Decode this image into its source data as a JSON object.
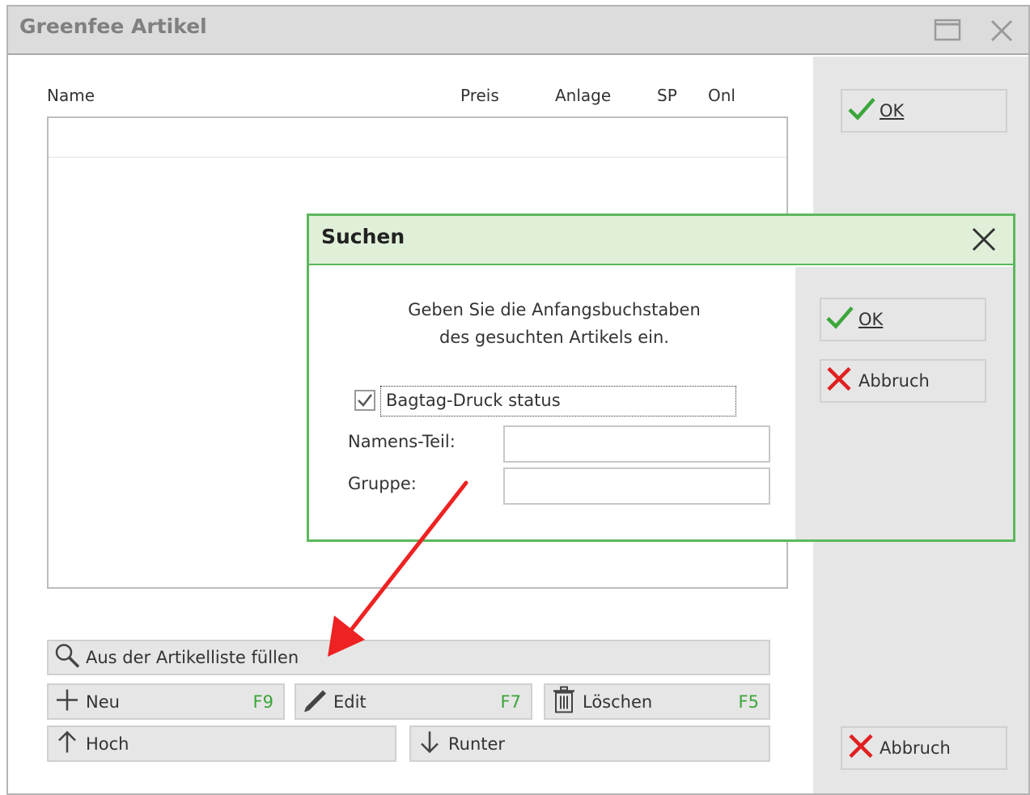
{
  "window": {
    "title": "Greenfee Artikel"
  },
  "list": {
    "columns": [
      "Name",
      "Preis",
      "Anlage",
      "SP",
      "Onl"
    ]
  },
  "sidebar": {
    "ok_label": "OK",
    "cancel_label": "Abbruch"
  },
  "buttons": {
    "fill_from_list": "Aus der Artikelliste füllen",
    "new": "Neu",
    "new_key": "F9",
    "edit": "Edit",
    "edit_key": "F7",
    "delete": "Löschen",
    "delete_key": "F5",
    "up": "Hoch",
    "down": "Runter"
  },
  "search_dialog": {
    "title": "Suchen",
    "message_line1": "Geben Sie die Anfangsbuchstaben",
    "message_line2": "des gesuchten Artikels ein.",
    "checkbox_label": "Bagtag-Druck status",
    "checkbox_checked": true,
    "name_part_label": "Namens-Teil:",
    "name_part_value": "",
    "group_label": "Gruppe:",
    "group_value": "",
    "ok_label": "OK",
    "cancel_label": "Abbruch"
  },
  "colors": {
    "accent_green": "#5cb85c",
    "cancel_red": "#e02020",
    "annotation_arrow": "#ee2222"
  }
}
